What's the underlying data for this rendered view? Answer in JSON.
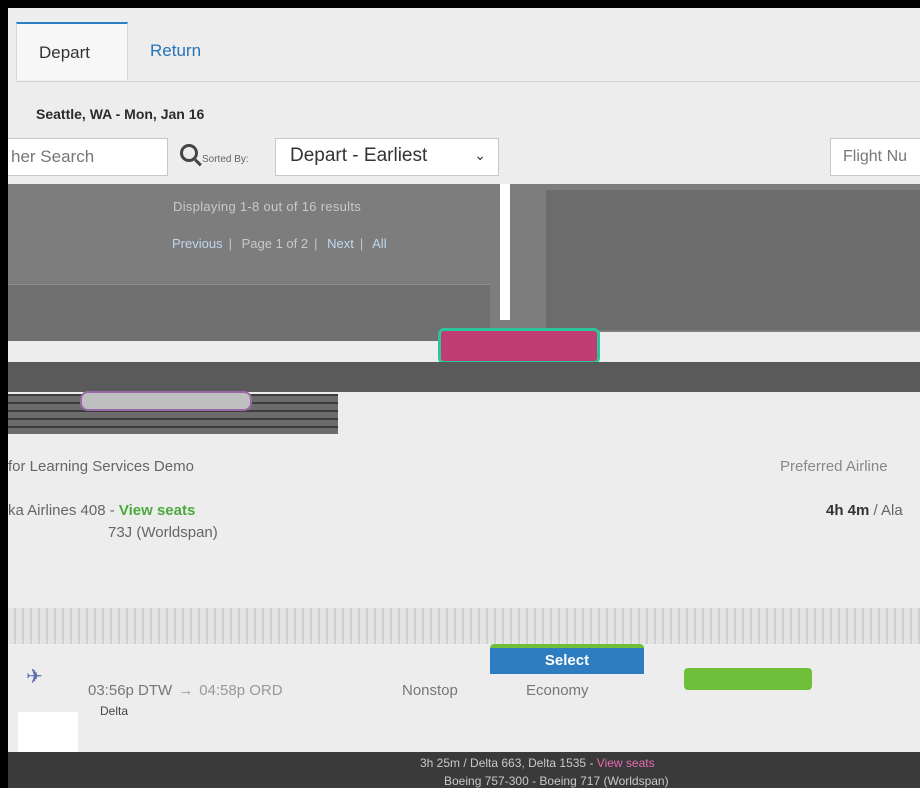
{
  "tabs": [
    {
      "label": "Depart"
    },
    {
      "label": "Return"
    }
  ],
  "route": "Seattle, WA - Mon, Jan 16",
  "filters": {
    "search_placeholder": "her Search",
    "sort_label": "Sorted By:",
    "sort_value": "Depart - Earliest",
    "flight_number_placeholder": "Flight Nu"
  },
  "paging": {
    "info": "Displaying 1-8 out of 16 results",
    "previous": "Previous",
    "page": "Page 1 of 2",
    "next": "Next",
    "all": "All"
  },
  "trip": {
    "agency": "for Learning Services Demo",
    "preferred": "Preferred Airline",
    "flight": "ka Airlines 408 - ",
    "view_seats": "View seats",
    "equipment": "73J (Worldspan)",
    "duration": "4h 4m",
    "airline": " / Ala"
  },
  "select_label": "Select",
  "segment": {
    "depart": "03:56p DTW",
    "arrive": "04:58p ORD",
    "stops": "Nonstop",
    "cabin": "Economy",
    "carrier": "Delta"
  },
  "footer": {
    "line1": "3h 25m / Delta 663, Delta 1535 - ",
    "view_seats": "View seats",
    "line2": "Boeing 757-300 - Boeing 717 (Worldspan)"
  },
  "colors": {
    "tab_accent": "#2c7ec5",
    "link": "#2a73b8",
    "green": "#4caa3c",
    "select_blue": "#2d7dc0"
  }
}
